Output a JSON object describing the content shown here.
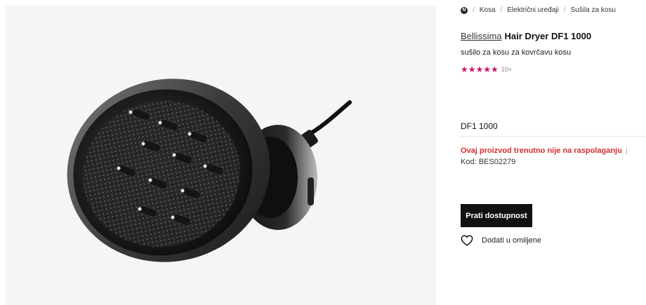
{
  "breadcrumb": {
    "home_icon": "n-logo-icon",
    "items": [
      "Kosa",
      "Električni uređaji",
      "Sušila za kosu"
    ]
  },
  "product": {
    "brand": "Bellissima",
    "name": "Hair Dryer DF1 1000",
    "subtitle": "sušilo za kosu za kovrčavu kosu",
    "rating": {
      "stars": 5,
      "stars_display": "★★★★★",
      "count": "10×"
    },
    "variant": "DF1 1000",
    "availability": {
      "status": "Ovaj proizvod trenutno nije na raspolaganju",
      "separator": "|",
      "code_label": "Kod:",
      "code": "BES02279"
    }
  },
  "actions": {
    "notify_label": "Prati dostupnost",
    "wishlist_label": "Dodati u omiljene",
    "wishlist_icon": "heart-icon"
  },
  "colors": {
    "accent": "#d1126b",
    "unavailable": "#d42f2f",
    "button_bg": "#111111",
    "image_bg": "#f5f5f5"
  }
}
